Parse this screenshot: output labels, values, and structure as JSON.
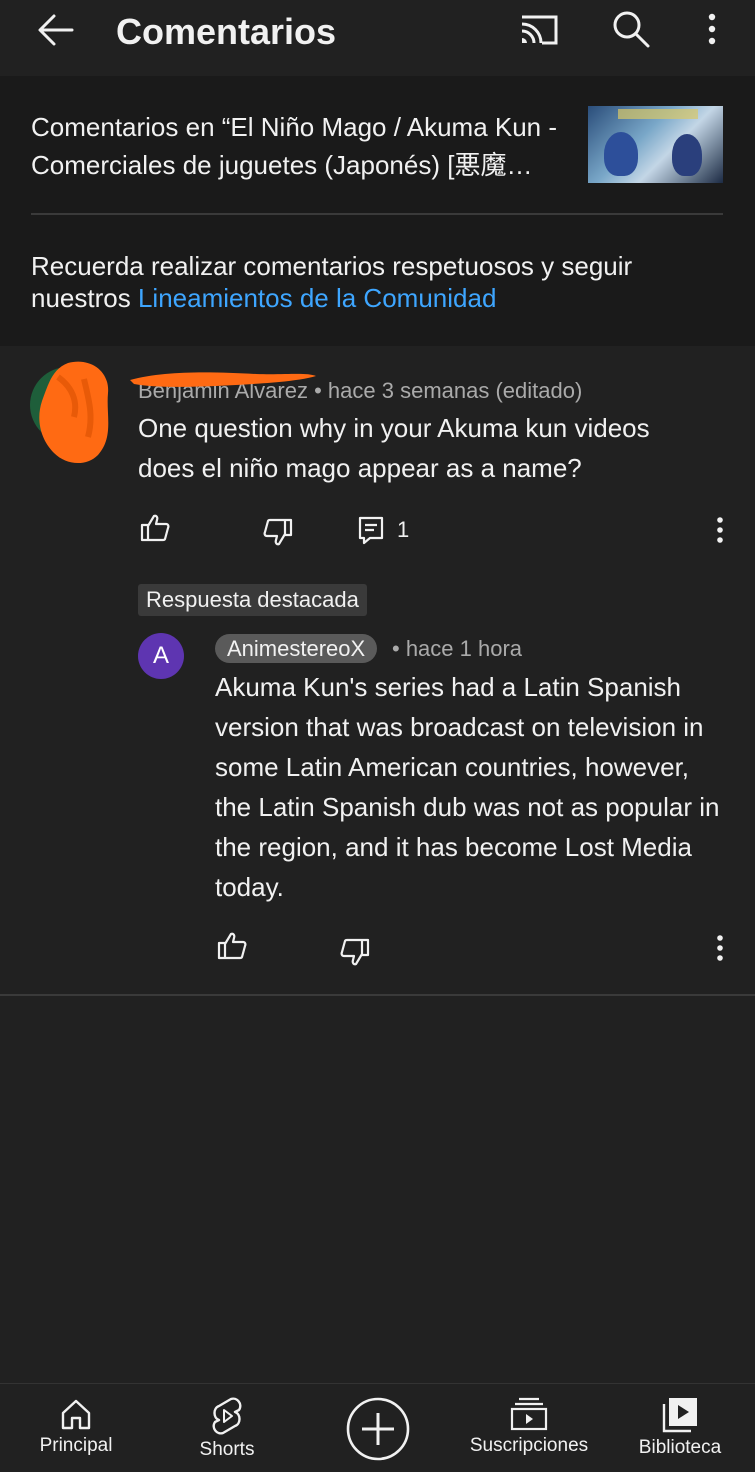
{
  "topbar": {
    "title": "Comentarios",
    "icons": [
      "back-arrow-icon",
      "cast-icon",
      "search-icon",
      "more-vert-icon"
    ]
  },
  "video": {
    "context_title": "Comentarios en “El Niño Mago / Akuma Kun - Comerciales de juguetes (Japonés) [悪魔…"
  },
  "guidelines": {
    "text": "Recuerda realizar comentarios respetuosos y seguir nuestros ",
    "link": "Lineamientos de la Comunidad",
    "link_color": "#3ea6ff"
  },
  "comment": {
    "author": "Benjamin Alvarez",
    "separator": " • ",
    "time": "hace 3 semanas (editado)",
    "text": "One question why in your Akuma kun videos does el niño mago appear as a name?",
    "reply_count": "1",
    "redaction_color": "#ff6a13"
  },
  "reply": {
    "badge": "Respuesta destacada",
    "avatar_letter": "A",
    "avatar_color": "#5e35b1",
    "author": "AnimestereoX",
    "time": "• hace 1 hora",
    "text": "Akuma Kun's series had a Latin Spanish version that was broadcast on television in some Latin American countries, however, the Latin Spanish dub was not as popular in the region, and it has become Lost Media today."
  },
  "nav": {
    "items": [
      {
        "label": "Principal",
        "icon": "home-icon"
      },
      {
        "label": "Shorts",
        "icon": "shorts-icon"
      },
      {
        "label": "",
        "icon": "create-plus-icon"
      },
      {
        "label": "Suscripciones",
        "icon": "subscriptions-icon"
      },
      {
        "label": "Biblioteca",
        "icon": "library-icon"
      }
    ]
  }
}
